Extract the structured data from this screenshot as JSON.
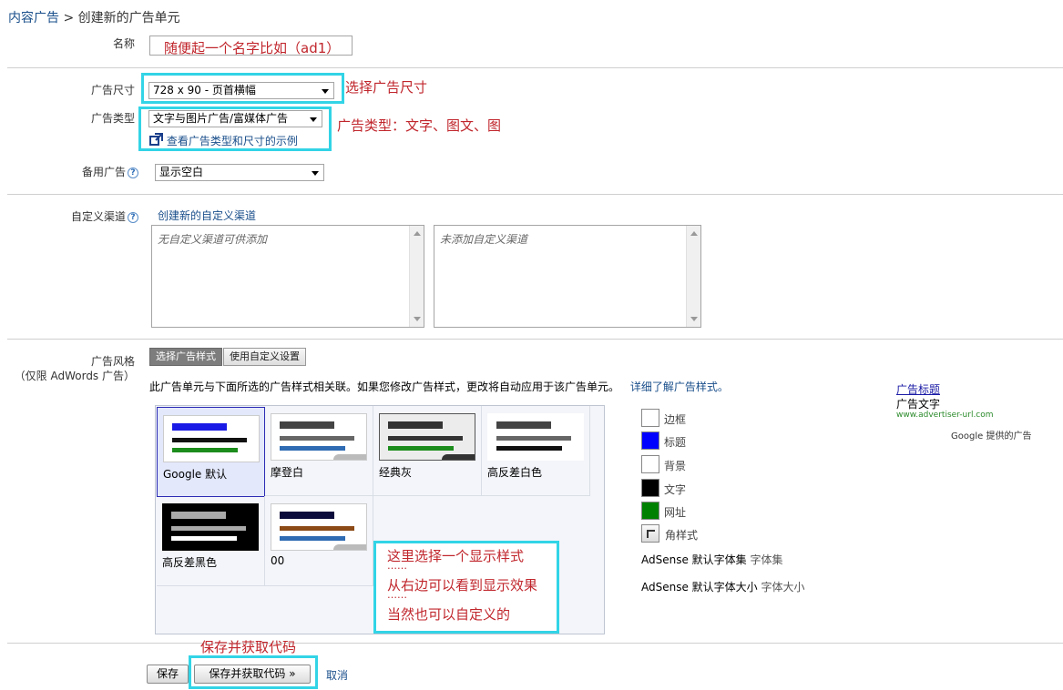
{
  "breadcrumb": {
    "parent": "内容广告",
    "separator": ">",
    "current": "创建新的广告单元"
  },
  "form": {
    "name_label": "名称",
    "name_value": "随便起一个名字比如（ad1）",
    "size_label": "广告尺寸",
    "size_value": "728 x 90 - 页首横幅",
    "type_label": "广告类型",
    "type_value": "文字与图片广告/富媒体广告",
    "type_examples_link": "查看广告类型和尺寸的示例",
    "backup_label": "备用广告",
    "backup_value": "显示空白",
    "channel_label": "自定义渠道",
    "channel_create_link": "创建新的自定义渠道",
    "channel_available_placeholder": "无自定义渠道可供添加",
    "channel_added_placeholder": "未添加自定义渠道",
    "style_label": "广告风格",
    "style_sublabel": "（仅限 AdWords 广告）",
    "style_tab_select": "选择广告样式",
    "style_tab_custom": "使用自定义设置",
    "style_description": "此广告单元与下面所选的广告样式相关联。如果您修改广告样式，更改将自动应用于该广告单元。",
    "style_learn_more": "详细了解广告样式。"
  },
  "styles": [
    {
      "name": "Google 默认",
      "selected": true
    },
    {
      "name": "摩登白",
      "selected": false
    },
    {
      "name": "经典灰",
      "selected": false
    },
    {
      "name": "高反差白色",
      "selected": false
    },
    {
      "name": "高反差黑色",
      "selected": false
    },
    {
      "name": "00",
      "selected": false
    }
  ],
  "palette": {
    "border": {
      "label": "边框",
      "color": "#ffffff"
    },
    "title": {
      "label": "标题",
      "color": "#0000ff"
    },
    "background": {
      "label": "背景",
      "color": "#ffffff"
    },
    "text": {
      "label": "文字",
      "color": "#000000"
    },
    "url": {
      "label": "网址",
      "color": "#008000"
    },
    "corner": {
      "label": "角样式"
    },
    "font_family": {
      "name": "AdSense 默认字体集",
      "label": "字体集"
    },
    "font_size": {
      "name": "AdSense 默认字体大小",
      "label": "字体大小"
    }
  },
  "preview": {
    "title": "广告标题",
    "text": "广告文字",
    "url": "www.advertiser-url.com",
    "attribution": "Google 提供的广告"
  },
  "buttons": {
    "save": "保存",
    "save_get_code": "保存并获取代码 »",
    "cancel": "取消"
  },
  "annotations": {
    "size": "选择广告尺寸",
    "type": "广告类型：文字、图文、图",
    "style_line1": "这里选择一个显示样式",
    "style_dots1": "……",
    "style_line2": "从右边可以看到显示效果",
    "style_dots2": "……",
    "style_line3": "当然也可以自定义的",
    "save": "保存并获取代码"
  }
}
